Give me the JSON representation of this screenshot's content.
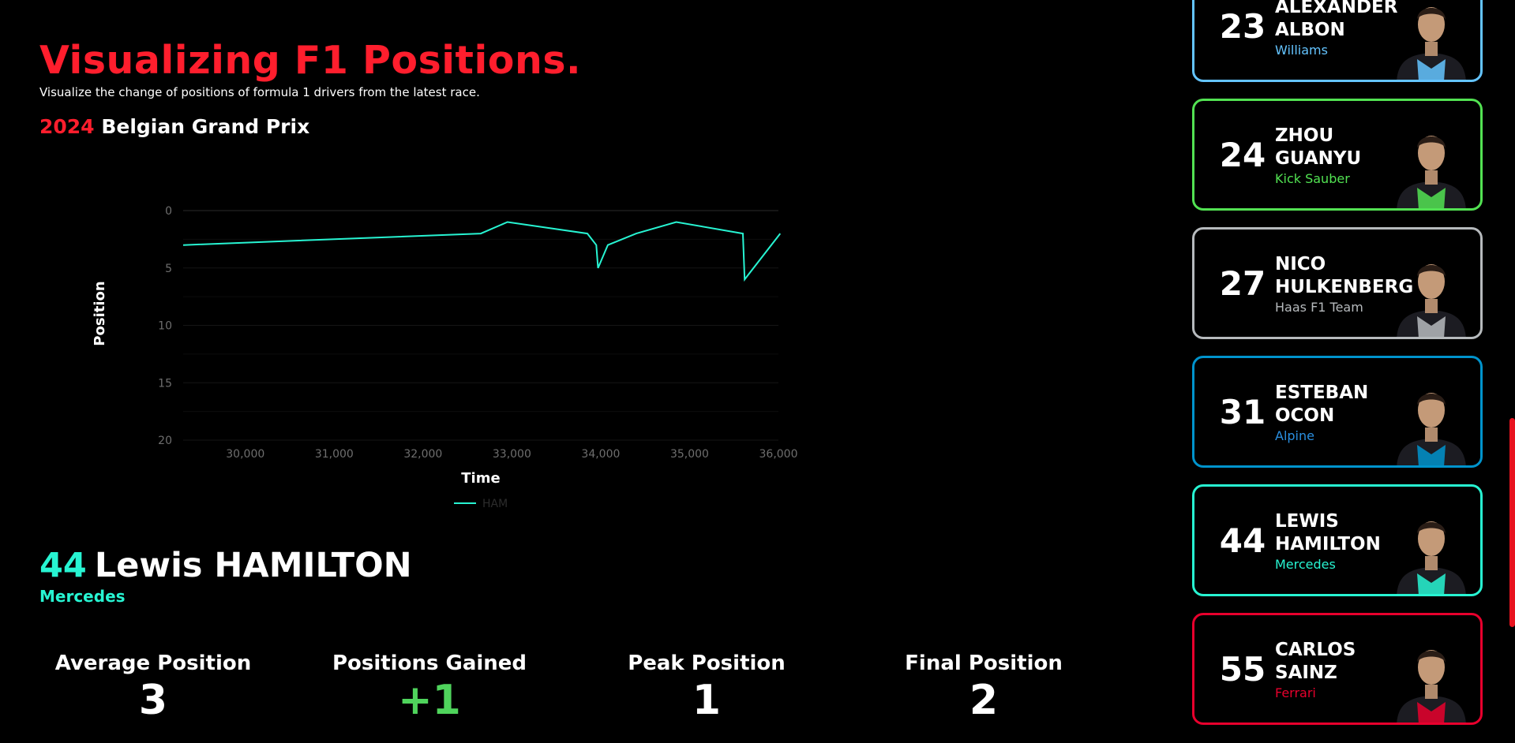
{
  "header": {
    "title": "Visualizing F1 Positions.",
    "subtitle": "Visualize the change of positions of formula 1 drivers from the latest race.",
    "race_year": "2024",
    "race_name": "Belgian Grand Prix"
  },
  "chart_data": {
    "type": "line",
    "xlabel": "Time",
    "ylabel": "Position",
    "xlim": [
      29300,
      36000
    ],
    "ylim": [
      0,
      20
    ],
    "y_reversed": true,
    "x_ticks": [
      30000,
      31000,
      32000,
      33000,
      34000,
      35000,
      36000
    ],
    "x_tick_labels": [
      "30,000",
      "31,000",
      "32,000",
      "33,000",
      "34,000",
      "35,000",
      "36,000"
    ],
    "y_ticks": [
      0,
      5,
      10,
      15,
      20
    ],
    "y_tick_labels": [
      "0",
      "5",
      "10",
      "15",
      "20"
    ],
    "grid": true,
    "legend": "bottom-center",
    "series": [
      {
        "name": "HAM",
        "color": "#27f4d2",
        "x": [
          29300,
          32650,
          32950,
          33850,
          33950,
          33970,
          34080,
          34400,
          34850,
          35600,
          35620,
          36020
        ],
        "y": [
          3,
          2,
          1,
          2,
          3,
          5,
          3,
          2,
          1,
          2,
          6,
          2
        ]
      }
    ]
  },
  "driver": {
    "number": "44",
    "name": "Lewis HAMILTON",
    "team": "Mercedes",
    "color": "#27f4d2"
  },
  "stats": [
    {
      "label": "Average Position",
      "value": "3",
      "color": "#ffffff"
    },
    {
      "label": "Positions Gained",
      "value": "+1",
      "color": "#4fd45c"
    },
    {
      "label": "Peak Position",
      "value": "1",
      "color": "#ffffff"
    },
    {
      "label": "Final Position",
      "value": "2",
      "color": "#ffffff"
    }
  ],
  "driver_cards": [
    {
      "number": "23",
      "first": "ALEXANDER",
      "last": "ALBON",
      "team": "Williams",
      "color": "#64c4ff",
      "team_color": "#64c4ff"
    },
    {
      "number": "24",
      "first": "ZHOU",
      "last": "GUANYU",
      "team": "Kick Sauber",
      "color": "#52e252",
      "team_color": "#52e252"
    },
    {
      "number": "27",
      "first": "NICO",
      "last": "HULKENBERG",
      "team": "Haas F1 Team",
      "color": "#b6babd",
      "team_color": "#b6babd"
    },
    {
      "number": "31",
      "first": "ESTEBAN",
      "last": "OCON",
      "team": "Alpine",
      "color": "#0093cc",
      "team_color": "#2a8fe0"
    },
    {
      "number": "44",
      "first": "LEWIS",
      "last": "HAMILTON",
      "team": "Mercedes",
      "color": "#27f4d2",
      "team_color": "#27f4d2"
    },
    {
      "number": "55",
      "first": "CARLOS",
      "last": "SAINZ",
      "team": "Ferrari",
      "color": "#e8002d",
      "team_color": "#e8002d"
    }
  ],
  "colors": {
    "accent": "#ff1e2d",
    "background": "#000000",
    "scrollbar": "#e8131f"
  }
}
